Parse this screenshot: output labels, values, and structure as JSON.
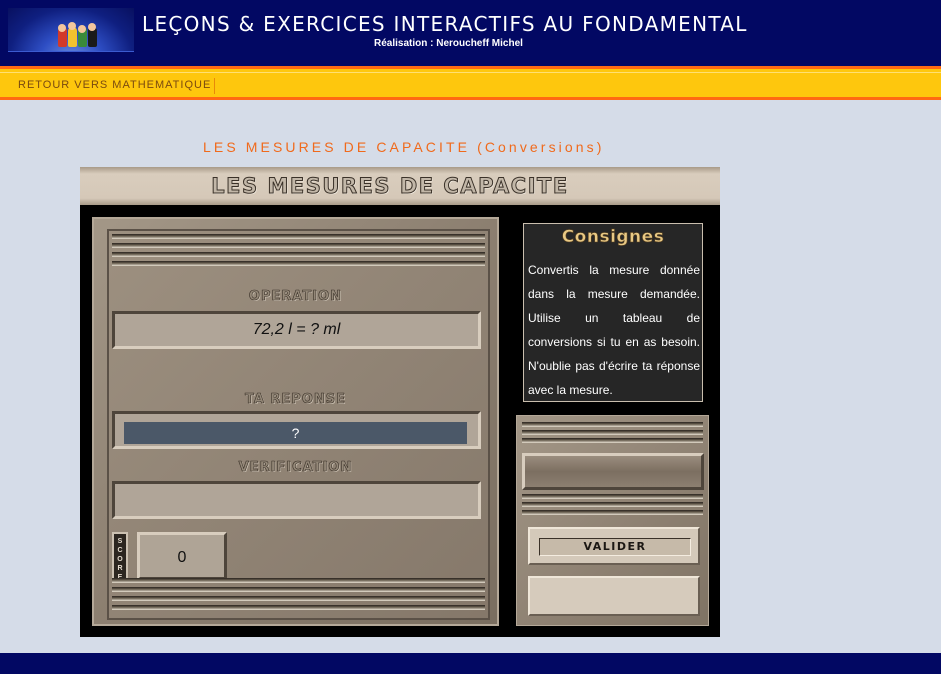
{
  "header": {
    "title": "LEÇONS & EXERCICES INTERACTIFS AU FONDAMENTAL",
    "author": "Réalisation : Neroucheff Michel"
  },
  "nav": {
    "back_link": "RETOUR VERS MATHEMATIQUE"
  },
  "page": {
    "title": "LES MESURES DE CAPACITE (Conversions)"
  },
  "exercise": {
    "banner": "LES MESURES DE CAPACITE",
    "operation_label": "OPERATION",
    "operation": "72,2 l = ? ml",
    "answer_label": "TA REPONSE",
    "answer_value": "?",
    "verification_label": "VERIFICATION",
    "verification_value": "",
    "score_label": "SCORE",
    "score_value": "0",
    "valider_label": "VALIDER"
  },
  "consignes": {
    "title": "Consignes",
    "text": "Convertis la mesure donnée dans la mesure demandée. Utilise un tableau de conversions si tu en as besoin. N'oublie pas d'écrire ta réponse avec la mesure."
  }
}
